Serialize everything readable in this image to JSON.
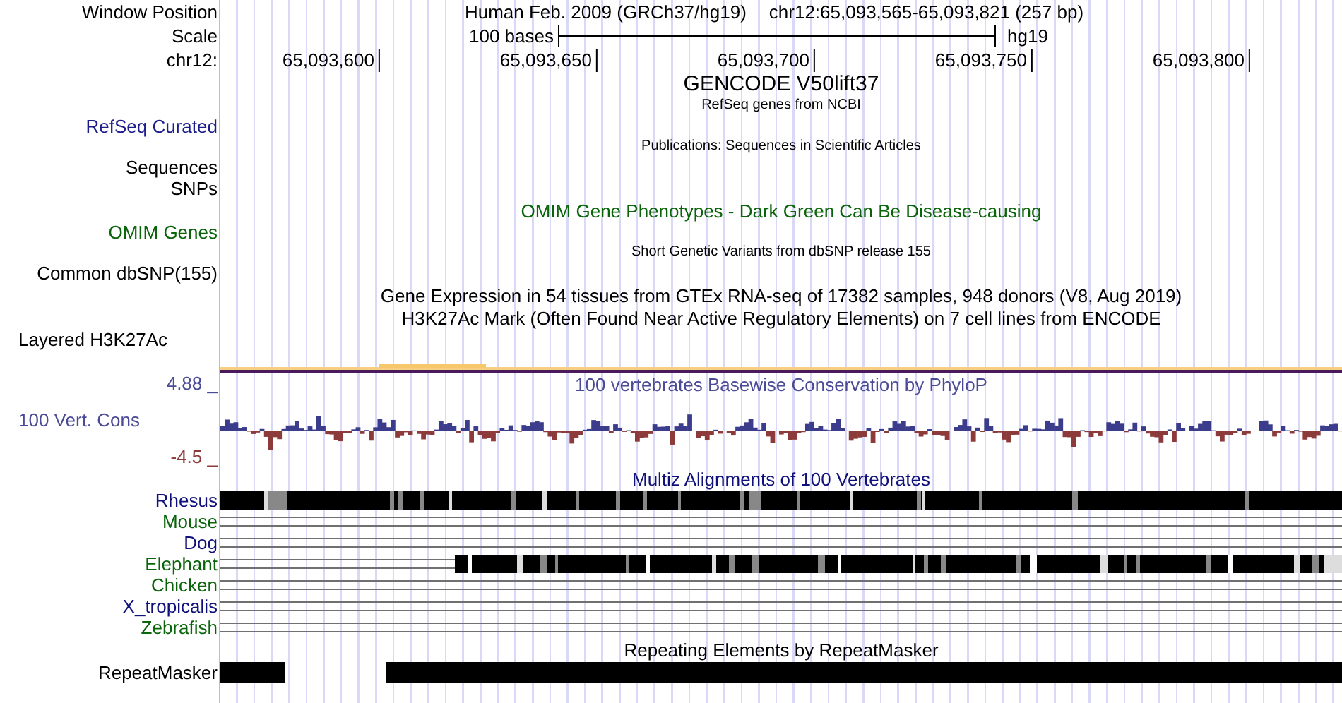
{
  "header": {
    "position_label": "Window Position",
    "assembly_title": "Human Feb. 2009 (GRCh37/hg19)",
    "position": "chr12:65,093,565-65,093,821 (257 bp)",
    "scale_label": "Scale",
    "scale_text": "100 bases",
    "scale_assembly": "hg19",
    "chrom_label": "chr12:",
    "ticks": [
      "65,093,600",
      "65,093,650",
      "65,093,700",
      "65,093,750",
      "65,093,800"
    ]
  },
  "rows": [
    {
      "kind": "heading",
      "text": "GENCODE V50lift37",
      "color": "#000000"
    },
    {
      "kind": "caption",
      "text": "RefSeq genes from NCBI",
      "color": "#000000"
    },
    {
      "kind": "label",
      "label": "RefSeq Curated",
      "color": "#1c1c8c"
    },
    {
      "kind": "caption",
      "text": "Publications: Sequences in Scientific Articles",
      "color": "#000000"
    },
    {
      "kind": "label",
      "label": "Sequences",
      "color": "#000000"
    },
    {
      "kind": "label",
      "label": "SNPs",
      "color": "#000000"
    },
    {
      "kind": "title",
      "text": "OMIM Gene Phenotypes - Dark Green Can Be Disease-causing",
      "color": "#0a640a"
    },
    {
      "kind": "label",
      "label": "OMIM Genes",
      "color": "#0a640a"
    },
    {
      "kind": "caption",
      "text": "Short Genetic Variants from dbSNP release 155",
      "color": "#000000"
    },
    {
      "kind": "label",
      "label": "Common dbSNP(155)",
      "color": "#000000"
    },
    {
      "kind": "title",
      "text": "Gene Expression in 54 tissues from GTEx RNA-seq of 17382 samples, 948 donors (V8, Aug 2019)",
      "color": "#000000"
    },
    {
      "kind": "title",
      "text": "H3K27Ac Mark (Often Found Near Active Regulatory Elements) on 7 cell lines from ENCODE",
      "color": "#000000"
    },
    {
      "kind": "signal",
      "label": "Layered H3K27Ac",
      "color": "#000000"
    },
    {
      "kind": "conservation",
      "label": "100 Vert. Cons",
      "color": "#4a4a96",
      "title": "100 vertebrates Basewise Conservation by PhyloP",
      "max": "4.88 _",
      "min": "-4.5 _"
    },
    {
      "kind": "title",
      "text": "Multiz Alignments of 100 Vertebrates",
      "color": "#10107a"
    },
    {
      "kind": "aligned",
      "label": "Rhesus",
      "color": "#10107a"
    },
    {
      "kind": "unaligned",
      "label": "Mouse",
      "color": "#0a640a"
    },
    {
      "kind": "unaligned",
      "label": "Dog",
      "color": "#10107a"
    },
    {
      "kind": "partly-aligned",
      "label": "Elephant",
      "color": "#0a640a"
    },
    {
      "kind": "unaligned",
      "label": "Chicken",
      "color": "#0a640a"
    },
    {
      "kind": "unaligned",
      "label": "X_tropicalis",
      "color": "#10107a"
    },
    {
      "kind": "unaligned",
      "label": "Zebrafish",
      "color": "#0a640a"
    },
    {
      "kind": "title",
      "text": "Repeating Elements by RepeatMasker",
      "color": "#000000"
    },
    {
      "kind": "repeat",
      "label": "RepeatMasker",
      "color": "#000000"
    }
  ]
}
